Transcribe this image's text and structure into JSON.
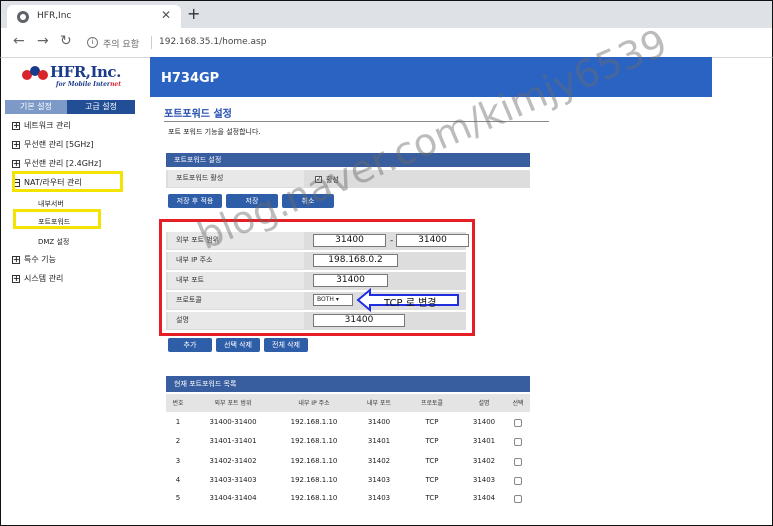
{
  "browser": {
    "tab_title": "HFR,Inc",
    "tab_close": "✕",
    "new_tab": "+",
    "back": "←",
    "forward": "→",
    "reload": "↻",
    "security_icon": "i",
    "security_status": "주의 요함",
    "url": "192.168.35.1/home.asp"
  },
  "brand": {
    "name": "HFR,Inc.",
    "tagline_prefix": "for Mobile Inter",
    "tagline_suffix": "net",
    "model": "H734GP"
  },
  "sidebar": {
    "tabs": [
      {
        "label": "기본 설정"
      },
      {
        "label": "고급 설정"
      }
    ],
    "items": [
      {
        "label": "네트워크 관리",
        "icon": "plus"
      },
      {
        "label": "무선랜 관리 [5GHz]",
        "icon": "plus"
      },
      {
        "label": "무선랜 관리 [2.4GHz]",
        "icon": "plus"
      },
      {
        "label": "NAT/라우터 관리",
        "icon": "minus"
      },
      {
        "label": "특수 기능",
        "icon": "plus"
      },
      {
        "label": "시스템 관리",
        "icon": "plus"
      }
    ],
    "subitems": [
      {
        "label": "내부서버"
      },
      {
        "label": "포트포워드"
      },
      {
        "label": "DMZ 설정"
      }
    ],
    "plus_glyph": "+",
    "minus_glyph": "−"
  },
  "page": {
    "title": "포트포워드 설정",
    "description": "포트 포워드 기능을 설정합니다.",
    "settings_header": "포트포워드 설정",
    "enable_label": "포트포워드 활성",
    "enable_checked": "✓",
    "enable_text": "활성",
    "buttons": {
      "save_apply": "저장 후 적용",
      "save": "저장",
      "cancel": "취소"
    }
  },
  "form": {
    "ext_port_label": "외부 포트 범위",
    "ext_port_start": "31400",
    "ext_port_end": "31400",
    "ext_port_sep": "-",
    "internal_ip_label": "내부 IP 주소",
    "internal_ip": "198.168.0.2",
    "internal_port_label": "내부 포트",
    "internal_port": "31400",
    "protocol_label": "프로토콜",
    "protocol": "BOTH ▾",
    "desc_label": "설명",
    "desc": "31400"
  },
  "actions": {
    "add": "추가",
    "delete_selected": "선택 삭제",
    "delete_all": "전체 삭제"
  },
  "annotation": {
    "callout": "TCP 로 변경",
    "highlight_color": "#e51f25",
    "arrow_color": "#1f2fe0",
    "marker_color": "#f2e300"
  },
  "list": {
    "title": "현재 포트포워드 목록",
    "columns": [
      "번호",
      "외부 포트 범위",
      "내부 IP 주소",
      "내부 포트",
      "프로토콜",
      "설명",
      "선택"
    ],
    "rows": [
      [
        "1",
        "31400-31400",
        "192.168.1.10",
        "31400",
        "TCP",
        "31400"
      ],
      [
        "2",
        "31401-31401",
        "192.168.1.10",
        "31401",
        "TCP",
        "31401"
      ],
      [
        "3",
        "31402-31402",
        "192.168.1.10",
        "31402",
        "TCP",
        "31402"
      ],
      [
        "4",
        "31403-31403",
        "192.168.1.10",
        "31403",
        "TCP",
        "31403"
      ],
      [
        "5",
        "31404-31404",
        "192.168.1.10",
        "31403",
        "TCP",
        "31404"
      ]
    ]
  },
  "watermark": "blog.naver.com/kimjy6539"
}
